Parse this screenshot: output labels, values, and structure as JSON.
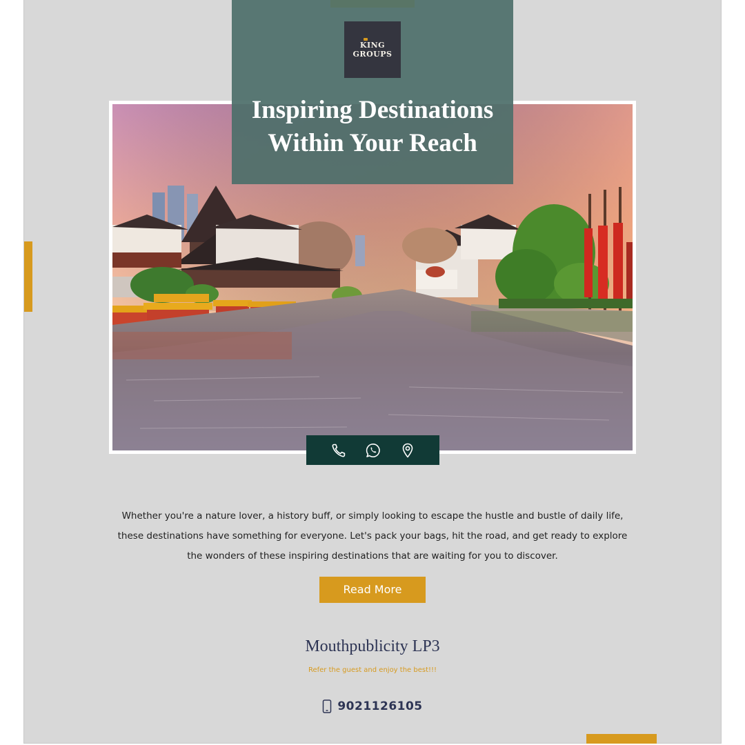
{
  "logo": {
    "line1": "KING",
    "line2": "GROUPS"
  },
  "hero": {
    "title_line1": "Inspiring Destinations",
    "title_line2": "Within Your Reach"
  },
  "contact_bar": {
    "icons": [
      "phone-icon",
      "whatsapp-icon",
      "location-pin-icon"
    ]
  },
  "body": {
    "line1": "Whether you're a nature lover, a history buff, or simply looking to escape the hustle and bustle of daily life,",
    "line2": "these destinations have something for everyone. Let's pack your bags, hit the road, and get ready to explore",
    "line3": "the wonders of these inspiring destinations that are waiting for you to discover."
  },
  "cta": {
    "read_more_label": "Read More"
  },
  "footer": {
    "brand_name": "Mouthpublicity LP3",
    "tagline": "Refer the guest and enjoy the best!!!",
    "phone": "9021126105"
  },
  "colors": {
    "background": "#d8d8d8",
    "accent": "#d79a1e",
    "accent_top": "#f0c22e",
    "title_panel": "#4d6f6a",
    "contact_bar": "#113a36",
    "brand_text": "#2d3454"
  }
}
